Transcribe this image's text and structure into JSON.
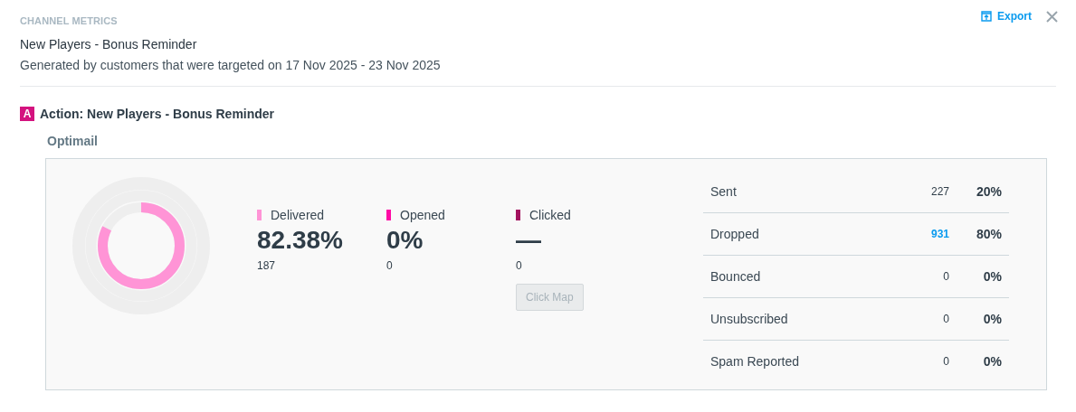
{
  "header": {
    "section_label": "CHANNEL METRICS",
    "title": "New Players - Bonus Reminder",
    "subtitle": "Generated by customers that were targeted on 17 Nov 2025 - 23 Nov 2025",
    "export_label": "Export"
  },
  "action": {
    "badge": "A",
    "label": "Action:",
    "name": "New Players - Bonus Reminder"
  },
  "channel": "Optimail",
  "metrics": [
    {
      "label": "Delivered",
      "value": "82.38%",
      "count": "187",
      "color": "#ff94d6"
    },
    {
      "label": "Opened",
      "value": "0%",
      "count": "0",
      "color": "#ff0aa5"
    },
    {
      "label": "Clicked",
      "value": "—",
      "count": "0",
      "color": "#a3135f"
    }
  ],
  "click_map": {
    "label": "Click Map",
    "disabled": true
  },
  "table": {
    "rows": [
      {
        "label": "Sent",
        "count": "227",
        "percent": "20%",
        "kind": "plain"
      },
      {
        "label": "Dropped",
        "count": "931",
        "percent": "80%",
        "kind": "link"
      },
      {
        "label": "Bounced",
        "count": "0",
        "percent": "0%",
        "kind": "plain"
      },
      {
        "label": "Unsubscribed",
        "count": "0",
        "percent": "0%",
        "kind": "plain"
      },
      {
        "label": "Spam Reported",
        "count": "0",
        "percent": "0%",
        "kind": "plain"
      }
    ]
  }
}
